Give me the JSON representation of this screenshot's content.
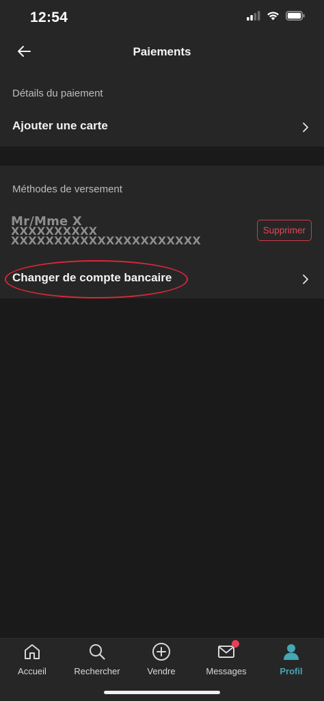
{
  "status_bar": {
    "time": "12:54"
  },
  "header": {
    "title": "Paiements"
  },
  "payment_details": {
    "section_label": "Détails du paiement",
    "add_card_label": "Ajouter une carte"
  },
  "payout_methods": {
    "section_label": "Méthodes de versement",
    "account": {
      "name": "Mr/Mme X",
      "line1": "XXXXXXXXXX",
      "line2": "XXXXXXXXXXXXXXXXXXXXXX"
    },
    "delete_label": "Supprimer",
    "change_account_label": "Changer de compte bancaire"
  },
  "tab_bar": {
    "tabs": [
      {
        "label": "Accueil",
        "icon": "home-icon"
      },
      {
        "label": "Rechercher",
        "icon": "search-icon"
      },
      {
        "label": "Vendre",
        "icon": "plus-circle-icon"
      },
      {
        "label": "Messages",
        "icon": "mail-icon"
      },
      {
        "label": "Profil",
        "icon": "person-icon",
        "active": true
      }
    ]
  },
  "colors": {
    "background": "#1a1a1a",
    "surface": "#262626",
    "accent": "#43a7b6",
    "danger": "#d23a4c"
  }
}
